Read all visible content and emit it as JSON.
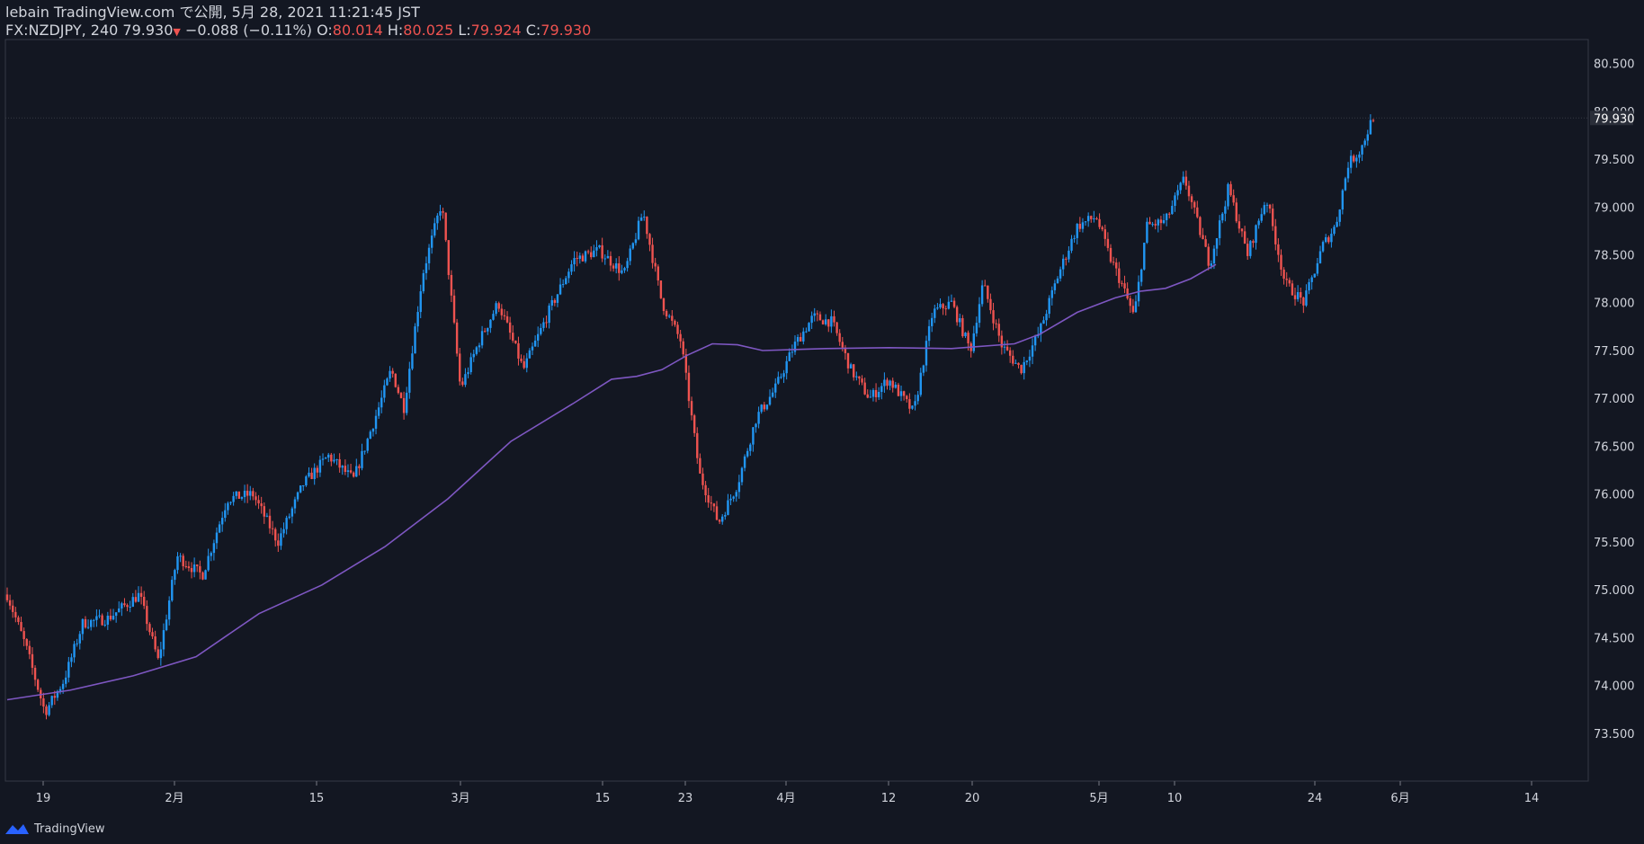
{
  "header": {
    "line1": "lebain TradingView.com で公開, 5月 28, 2021 11:21:45 JST",
    "symbol": "FX:NZDJPY, 240",
    "last": "79.930",
    "change": "−0.088 (−0.11%)",
    "o_label": "O:",
    "o_value": "80.014",
    "h_label": "H:",
    "h_value": "80.025",
    "l_label": "L:",
    "l_value": "79.924",
    "c_label": "C:",
    "c_value": "79.930"
  },
  "footer": {
    "brand": "TradingView"
  },
  "colors": {
    "background": "#131722",
    "up": "#2196f3",
    "down": "#ef5350",
    "ma": "#7e57c2",
    "grid_text": "#d1d4dc",
    "axis_line": "#363a45"
  },
  "chart_data": {
    "type": "candlestick",
    "symbol": "FX:NZDJPY",
    "interval": "240",
    "ylim": [
      73.0,
      80.75
    ],
    "y_ticks": [
      "73.500",
      "74.000",
      "74.500",
      "75.000",
      "75.500",
      "76.000",
      "76.500",
      "77.000",
      "77.500",
      "78.000",
      "78.500",
      "79.000",
      "79.500",
      "80.000",
      "80.500"
    ],
    "last_price_label": "79.930",
    "x_ticks": [
      "19",
      "2月",
      "15",
      "3月",
      "15",
      "23",
      "4月",
      "12",
      "20",
      "5月",
      "10",
      "24",
      "6月",
      "14"
    ],
    "price_anchors": [
      {
        "t": 0,
        "v": 74.95
      },
      {
        "t": 0.015,
        "v": 74.4
      },
      {
        "t": 0.03,
        "v": 73.72
      },
      {
        "t": 0.045,
        "v": 74.05
      },
      {
        "t": 0.06,
        "v": 74.65
      },
      {
        "t": 0.08,
        "v": 74.7
      },
      {
        "t": 0.105,
        "v": 74.95
      },
      {
        "t": 0.12,
        "v": 74.25
      },
      {
        "t": 0.135,
        "v": 75.35
      },
      {
        "t": 0.155,
        "v": 75.15
      },
      {
        "t": 0.175,
        "v": 75.95
      },
      {
        "t": 0.195,
        "v": 76.0
      },
      {
        "t": 0.215,
        "v": 75.5
      },
      {
        "t": 0.235,
        "v": 76.1
      },
      {
        "t": 0.255,
        "v": 76.4
      },
      {
        "t": 0.275,
        "v": 76.15
      },
      {
        "t": 0.295,
        "v": 76.9
      },
      {
        "t": 0.305,
        "v": 77.3
      },
      {
        "t": 0.315,
        "v": 76.9
      },
      {
        "t": 0.33,
        "v": 78.3
      },
      {
        "t": 0.345,
        "v": 79.05
      },
      {
        "t": 0.36,
        "v": 77.1
      },
      {
        "t": 0.375,
        "v": 77.6
      },
      {
        "t": 0.39,
        "v": 78.0
      },
      {
        "t": 0.41,
        "v": 77.3
      },
      {
        "t": 0.43,
        "v": 77.9
      },
      {
        "t": 0.45,
        "v": 78.45
      },
      {
        "t": 0.47,
        "v": 78.55
      },
      {
        "t": 0.49,
        "v": 78.3
      },
      {
        "t": 0.505,
        "v": 78.95
      },
      {
        "t": 0.52,
        "v": 78.0
      },
      {
        "t": 0.535,
        "v": 77.6
      },
      {
        "t": 0.55,
        "v": 76.2
      },
      {
        "t": 0.565,
        "v": 75.7
      },
      {
        "t": 0.58,
        "v": 76.1
      },
      {
        "t": 0.595,
        "v": 76.8
      },
      {
        "t": 0.61,
        "v": 77.1
      },
      {
        "t": 0.625,
        "v": 77.55
      },
      {
        "t": 0.64,
        "v": 77.85
      },
      {
        "t": 0.655,
        "v": 77.8
      },
      {
        "t": 0.67,
        "v": 77.3
      },
      {
        "t": 0.685,
        "v": 77.0
      },
      {
        "t": 0.7,
        "v": 77.2
      },
      {
        "t": 0.72,
        "v": 76.85
      },
      {
        "t": 0.735,
        "v": 77.9
      },
      {
        "t": 0.75,
        "v": 78.0
      },
      {
        "t": 0.765,
        "v": 77.5
      },
      {
        "t": 0.775,
        "v": 78.2
      },
      {
        "t": 0.79,
        "v": 77.55
      },
      {
        "t": 0.805,
        "v": 77.3
      },
      {
        "t": 0.82,
        "v": 77.7
      },
      {
        "t": 0.835,
        "v": 78.3
      },
      {
        "t": 0.85,
        "v": 78.8
      },
      {
        "t": 0.865,
        "v": 78.9
      },
      {
        "t": 0.875,
        "v": 78.5
      },
      {
        "t": 0.885,
        "v": 78.2
      },
      {
        "t": 0.895,
        "v": 77.85
      },
      {
        "t": 0.905,
        "v": 78.8
      },
      {
        "t": 0.92,
        "v": 78.85
      },
      {
        "t": 0.935,
        "v": 79.3
      },
      {
        "t": 0.955,
        "v": 78.4
      },
      {
        "t": 0.97,
        "v": 79.2
      },
      {
        "t": 0.985,
        "v": 78.5
      },
      {
        "t": 1.0,
        "v": 79.1
      },
      {
        "t": 1.015,
        "v": 78.2
      },
      {
        "t": 1.03,
        "v": 78.0
      },
      {
        "t": 1.045,
        "v": 78.6
      },
      {
        "t": 1.055,
        "v": 78.8
      },
      {
        "t": 1.065,
        "v": 79.45
      },
      {
        "t": 1.075,
        "v": 79.6
      },
      {
        "t": 1.085,
        "v": 79.95
      }
    ],
    "moving_average": [
      {
        "t": 0,
        "v": 73.85
      },
      {
        "t": 0.05,
        "v": 73.95
      },
      {
        "t": 0.1,
        "v": 74.1
      },
      {
        "t": 0.15,
        "v": 74.3
      },
      {
        "t": 0.2,
        "v": 74.75
      },
      {
        "t": 0.25,
        "v": 75.05
      },
      {
        "t": 0.3,
        "v": 75.45
      },
      {
        "t": 0.35,
        "v": 75.95
      },
      {
        "t": 0.4,
        "v": 76.55
      },
      {
        "t": 0.45,
        "v": 76.95
      },
      {
        "t": 0.48,
        "v": 77.2
      },
      {
        "t": 0.5,
        "v": 77.23
      },
      {
        "t": 0.52,
        "v": 77.3
      },
      {
        "t": 0.54,
        "v": 77.45
      },
      {
        "t": 0.56,
        "v": 77.57
      },
      {
        "t": 0.58,
        "v": 77.56
      },
      {
        "t": 0.6,
        "v": 77.5
      },
      {
        "t": 0.65,
        "v": 77.52
      },
      {
        "t": 0.7,
        "v": 77.53
      },
      {
        "t": 0.75,
        "v": 77.52
      },
      {
        "t": 0.8,
        "v": 77.57
      },
      {
        "t": 0.82,
        "v": 77.67
      },
      {
        "t": 0.85,
        "v": 77.9
      },
      {
        "t": 0.88,
        "v": 78.05
      },
      {
        "t": 0.9,
        "v": 78.12
      },
      {
        "t": 0.92,
        "v": 78.15
      },
      {
        "t": 0.94,
        "v": 78.25
      },
      {
        "t": 0.96,
        "v": 78.4
      }
    ]
  }
}
